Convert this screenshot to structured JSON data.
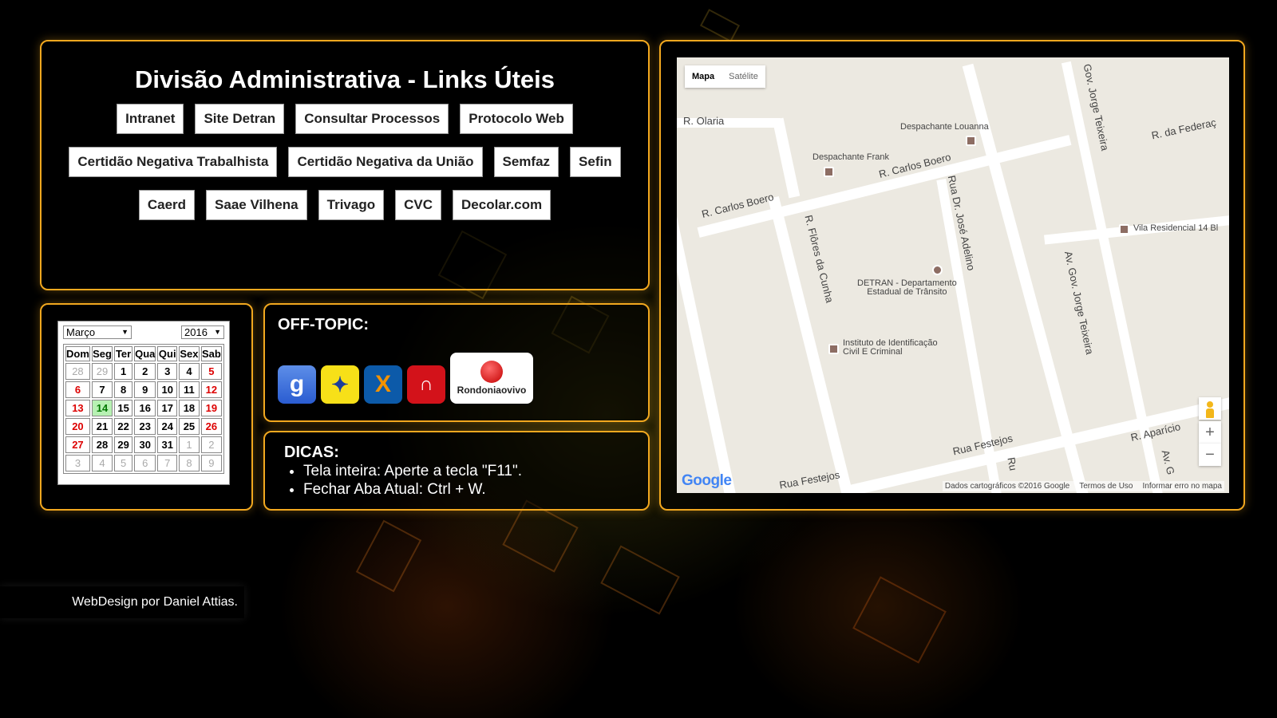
{
  "links": {
    "title": "Divisão Administrativa - Links Úteis",
    "rows": [
      [
        "Intranet",
        "Site Detran",
        "Consultar Processos",
        "Protocolo Web"
      ],
      [
        "Certidão Negativa Trabalhista",
        "Certidão Negativa da União",
        "Semfaz",
        "Sefin"
      ],
      [
        "Caerd",
        "Saae Vilhena",
        "Trivago",
        "CVC",
        "Decolar.com"
      ]
    ]
  },
  "calendar": {
    "month": "Março",
    "year": "2016",
    "weekdays": [
      "Dom",
      "Seg",
      "Ter",
      "Qua",
      "Qui",
      "Sex",
      "Sab"
    ],
    "weeks": [
      [
        "28",
        "29",
        "1",
        "2",
        "3",
        "4",
        "5"
      ],
      [
        "6",
        "7",
        "8",
        "9",
        "10",
        "11",
        "12"
      ],
      [
        "13",
        "14",
        "15",
        "16",
        "17",
        "18",
        "19"
      ],
      [
        "20",
        "21",
        "22",
        "23",
        "24",
        "25",
        "26"
      ],
      [
        "27",
        "28",
        "29",
        "30",
        "31",
        "1",
        "2"
      ],
      [
        "3",
        "4",
        "5",
        "6",
        "7",
        "8",
        "9"
      ]
    ],
    "today": "14"
  },
  "offtopic": {
    "heading": "OFF-TOPIC:",
    "icons": {
      "google": "g",
      "banco_brasil": "✦",
      "caixa": "X",
      "bradesco": "∩",
      "rondonia": "Rondoniaovivo"
    }
  },
  "dicas": {
    "heading": "DICAS:",
    "items": [
      "Tela inteira: Aperte a tecla \"F11\".",
      "Fechar Aba Atual: Ctrl + W."
    ]
  },
  "map": {
    "type_map": "Mapa",
    "type_satellite": "Satélite",
    "streets": {
      "olaria": "R. Olaria",
      "carlos_boero_1": "R. Carlos Boero",
      "carlos_boero_2": "R. Carlos Boero",
      "flores_cunha": "R. Flôres da Cunha",
      "jose_adelino": "Rua Dr. José Adelino",
      "gov_jorge_1": "Gov. Jorge Teixeira",
      "gov_jorge_2": "Av. Gov. Jorge Teixeira",
      "festejos_1": "Rua Festejos",
      "festejos_2": "Rua Festejos",
      "aparicio": "R. Aparício",
      "federacao": "R. da Federaç",
      "av_g": "Av. G",
      "ru": "Ru"
    },
    "pois": {
      "louanna": "Despachante Louanna",
      "frank": "Despachante Frank",
      "vila": "Vila Residencial 14 Bl",
      "detran": "DETRAN - Departamento\nEstadual de Trânsito",
      "instituto": "Instituto de Identificação\nCivil E Criminal"
    },
    "zoom_in": "+",
    "zoom_out": "−",
    "logo": "Google",
    "attribution": "Dados cartográficos ©2016 Google",
    "terms": "Termos de Uso",
    "report": "Informar erro no mapa"
  },
  "footer": {
    "credit": "WebDesign por Daniel Attias."
  },
  "colors": {
    "accent": "#f2a81f",
    "today_bg": "#b7f1b3",
    "weekend": "#dd0000"
  }
}
